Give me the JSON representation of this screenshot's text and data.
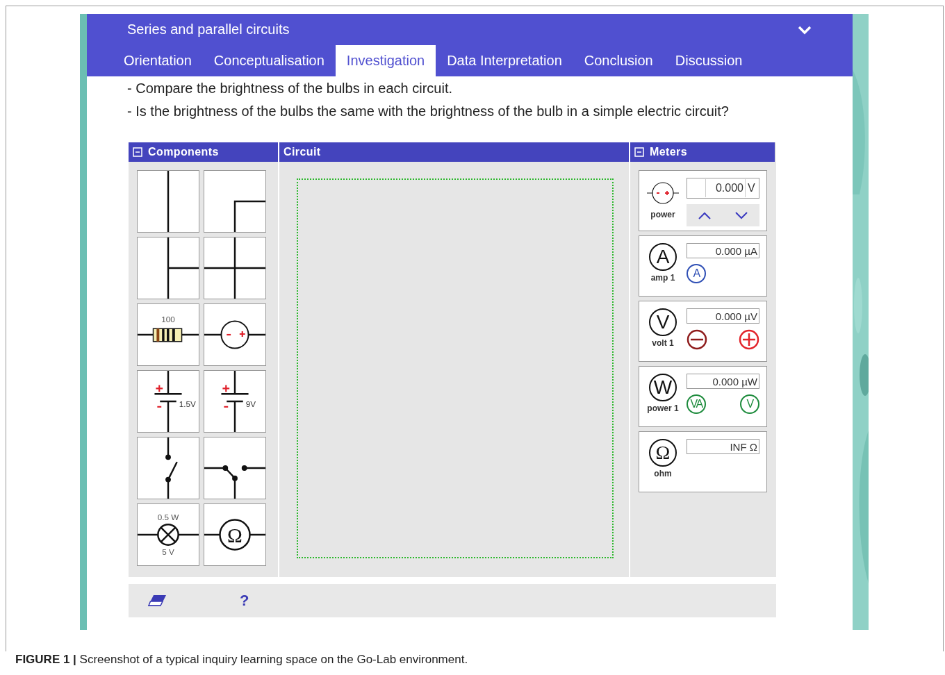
{
  "header": {
    "title": "Series and parallel circuits"
  },
  "tabs": [
    {
      "label": "Orientation",
      "selected": false
    },
    {
      "label": "Conceptualisation",
      "selected": false
    },
    {
      "label": "Investigation",
      "selected": true
    },
    {
      "label": "Data Interpretation",
      "selected": false
    },
    {
      "label": "Conclusion",
      "selected": false
    },
    {
      "label": "Discussion",
      "selected": false
    }
  ],
  "instructions": [
    "- Compare the brightness of the bulbs in each circuit.",
    "- Is the brightness of the bulbs the same with the brightness of the bulb in a simple electric circuit?"
  ],
  "lab": {
    "components_title": "Components",
    "circuit_title": "Circuit",
    "meters_title": "Meters",
    "components": [
      {
        "kind": "wire-straight"
      },
      {
        "kind": "wire-corner"
      },
      {
        "kind": "wire-tee"
      },
      {
        "kind": "wire-cross"
      },
      {
        "kind": "resistor",
        "label": "100"
      },
      {
        "kind": "source"
      },
      {
        "kind": "battery",
        "label": "1.5V"
      },
      {
        "kind": "battery",
        "label": "9V"
      },
      {
        "kind": "switch"
      },
      {
        "kind": "switch-double"
      },
      {
        "kind": "bulb",
        "label": "0.5 W",
        "label_2": "5 V"
      },
      {
        "kind": "ohm",
        "symbol": "Ω"
      }
    ],
    "meters": [
      {
        "kind": "source",
        "label": "power",
        "value": "0.000",
        "unit": "V"
      },
      {
        "kind": "meter",
        "symbol": "A",
        "label": "amp 1",
        "reading": "0.000 µA",
        "buttons": [
          {
            "kind": "text",
            "text": "A",
            "color": "#2f4fb5"
          }
        ]
      },
      {
        "kind": "meter",
        "symbol": "V",
        "label": "volt 1",
        "reading": "0.000 µV",
        "buttons": [
          {
            "kind": "minus",
            "color": "#8e1b1b"
          },
          {
            "kind": "plus",
            "color": "#e2232a"
          }
        ]
      },
      {
        "kind": "meter",
        "symbol": "W",
        "label": "power 1",
        "reading": "0.000 µW",
        "buttons": [
          {
            "kind": "text",
            "text": "VA",
            "color": "#1d8b3c"
          },
          {
            "kind": "text",
            "text": "V",
            "color": "#1d8b3c"
          }
        ]
      },
      {
        "kind": "meter",
        "symbol": "Ω",
        "label": "ohm",
        "reading": "INF Ω"
      }
    ]
  },
  "toolbar": {
    "help": "?"
  },
  "caption": "**FIGURE 1 |** Screenshot of a typical inquiry learning space on the Go-Lab environment."
}
